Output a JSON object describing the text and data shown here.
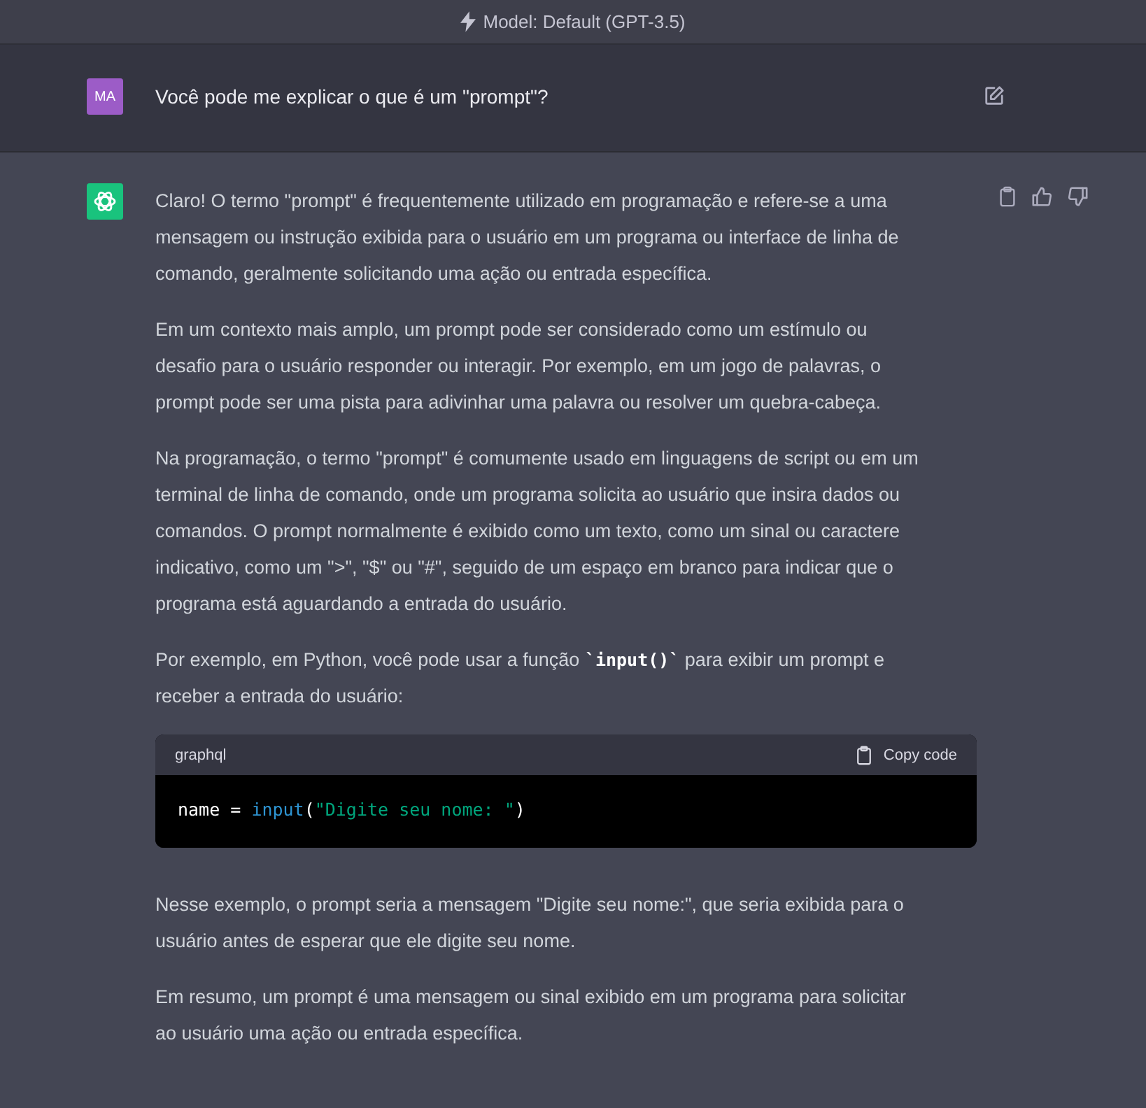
{
  "model_bar": {
    "label": "Model: Default (GPT-3.5)"
  },
  "user_message": {
    "avatar": "MA",
    "text": "Você pode me explicar o que é um \"prompt\"?"
  },
  "assistant_message": {
    "blocks": [
      {
        "kind": "paragraph",
        "text": "Claro! O termo \"prompt\" é frequentemente utilizado em programação e refere-se a uma mensagem ou instrução exibida para o usuário em um programa ou interface de linha de comando, geralmente solicitando uma ação ou entrada específica."
      },
      {
        "kind": "paragraph",
        "text": "Em um contexto mais amplo, um prompt pode ser considerado como um estímulo ou desafio para o usuário responder ou interagir. Por exemplo, em um jogo de palavras, o prompt pode ser uma pista para adivinhar uma palavra ou resolver um quebra-cabeça."
      },
      {
        "kind": "paragraph",
        "text": "Na programação, o termo \"prompt\" é comumente usado em linguagens de script ou em um terminal de linha de comando, onde um programa solicita ao usuário que insira dados ou comandos. O prompt normalmente é exibido como um texto, como um sinal ou caractere indicativo, como um \">\", \"$\" ou \"#\", seguido de um espaço em branco para indicar que o programa está aguardando a entrada do usuário."
      },
      {
        "kind": "paragraph",
        "text": "Por exemplo, em Python, você pode usar a função **`input()`** para exibir um prompt e receber a entrada do usuário:"
      },
      {
        "kind": "code",
        "language": "graphql",
        "copy_label": "Copy code",
        "tokens": [
          {
            "kind": "plain",
            "text": "name = "
          },
          {
            "kind": "builtin",
            "text": "input"
          },
          {
            "kind": "plain",
            "text": "("
          },
          {
            "kind": "string",
            "text": "\"Digite seu nome: \""
          },
          {
            "kind": "plain",
            "text": ")"
          }
        ]
      },
      {
        "kind": "paragraph",
        "text": "Nesse exemplo, o prompt seria a mensagem \"Digite seu nome:\", que seria exibida para o usuário antes de esperar que ele digite seu nome."
      },
      {
        "kind": "paragraph",
        "text": "Em resumo, um prompt é uma mensagem ou sinal exibido em um programa para solicitar ao usuário uma ação ou entrada específica."
      }
    ]
  }
}
